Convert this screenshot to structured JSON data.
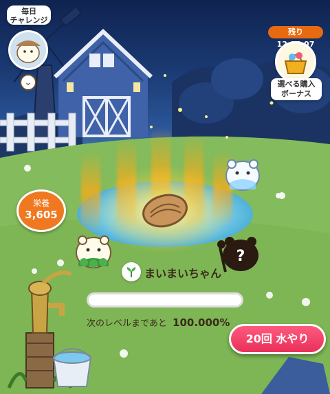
{
  "daily": {
    "label_line1": "毎日",
    "label_line2": "チャレンジ"
  },
  "timer": {
    "text": "残り 12:25:07"
  },
  "bonus": {
    "line1": "選べる購入",
    "line2": "ボーナス"
  },
  "nutrition": {
    "label": "栄養",
    "value": "3,605"
  },
  "plant": {
    "name": "まいまいちゃん",
    "level_text": "次のレベルまであと",
    "level_percent": "100.000%",
    "progress": 0.0
  },
  "water_button": {
    "label": "20回 水やり"
  },
  "colors": {
    "water_button": "#e8305a",
    "nutrition_badge": "#f07820",
    "timer_badge": "#e86a10"
  }
}
